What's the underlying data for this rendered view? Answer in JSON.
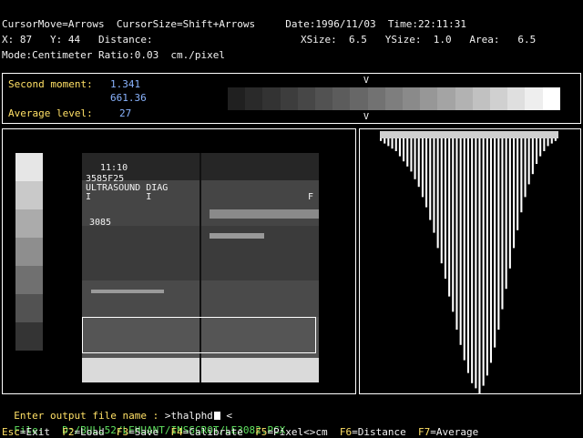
{
  "header": {
    "line1": "CursorMove=Arrows  CursorSize=Shift+Arrows     Date:1996/11/03  Time:22:11:31",
    "line2_left": "X: 87   Y: 44   Distance:",
    "line2_right": "XSize:  6.5   YSize:  1.0   Area:   6.5",
    "line3": "Mode:Centimeter Ratio:0.03  cm./pixel"
  },
  "stats": {
    "second_moment_label": "Second moment:",
    "second_moment_value": "1.341",
    "second_moment_value2": "661.36",
    "average_label": "Average level:",
    "average_value": "27",
    "marker_top": "V",
    "marker_bottom": "V",
    "strip_colors": [
      "#202020",
      "#2a2a2a",
      "#333333",
      "#3d3d3d",
      "#474747",
      "#525252",
      "#5c5c5c",
      "#676767",
      "#727272",
      "#7e7e7e",
      "#8a8a8a",
      "#979797",
      "#a4a4a4",
      "#b2b2b2",
      "#c1c1c1",
      "#d0d0d0",
      "#dfdfdf",
      "#eeeeee",
      "#ffffff"
    ]
  },
  "image_panel": {
    "overlay_line1": "11:10",
    "overlay_line2": "3585F25",
    "overlay_line3": "ULTRASOUND DIAG",
    "overlay_line4": "I          I",
    "overlay_line5": "3085",
    "corner_right": "F",
    "swatch_colors": [
      "#e6e6e6",
      "#c9c9c9",
      "#ababab",
      "#8e8e8e",
      "#707070",
      "#525252",
      "#343434"
    ]
  },
  "histogram": {
    "values": [
      0.01,
      0.02,
      0.03,
      0.04,
      0.05,
      0.07,
      0.09,
      0.11,
      0.13,
      0.16,
      0.19,
      0.23,
      0.27,
      0.32,
      0.37,
      0.43,
      0.49,
      0.55,
      0.62,
      0.68,
      0.75,
      0.81,
      0.87,
      0.92,
      0.96,
      0.98,
      1.0,
      0.97,
      0.93,
      0.88,
      0.82,
      0.75,
      0.67,
      0.59,
      0.51,
      0.43,
      0.36,
      0.29,
      0.23,
      0.18,
      0.14,
      0.1,
      0.07,
      0.05,
      0.03,
      0.02,
      0.01
    ]
  },
  "prompt": {
    "label": "Enter output file name : ",
    "value": ">thalphd"
  },
  "file": {
    "label": "File:",
    "path": "D:/BULL52/LEHUANT/INSSCROT/LE3082.PCX"
  },
  "fkeys": [
    {
      "key": "Esc",
      "label": "=Exit"
    },
    {
      "key": "F2",
      "label": "=Load"
    },
    {
      "key": "F3",
      "label": "=Save"
    },
    {
      "key": "F4",
      "label": "=Calibrate"
    },
    {
      "key": "F5",
      "label": "=Pixel<>cm"
    },
    {
      "key": "F6",
      "label": "=Distance"
    },
    {
      "key": "F7",
      "label": "=Average"
    }
  ]
}
